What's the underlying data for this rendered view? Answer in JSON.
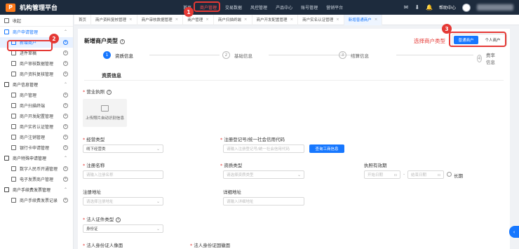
{
  "brand": {
    "name": "机构管理平台",
    "logo_text": "P"
  },
  "nav": [
    "首页",
    "商户管理",
    "交易数据",
    "风控管理",
    "产品中心",
    "账号管理",
    "营销平台"
  ],
  "top_right": {
    "help": "帮助中心",
    "icons": [
      "mail-icon",
      "download-icon",
      "bell-icon"
    ]
  },
  "sidebar": {
    "collapse": "收起",
    "items": [
      {
        "label": "商户申请管理",
        "type": "group",
        "open": true
      },
      {
        "label": "新增商户",
        "type": "item",
        "active": true
      },
      {
        "label": "进件草稿",
        "type": "item"
      },
      {
        "label": "商户审核数据管理",
        "type": "item"
      },
      {
        "label": "商户资料复核管理",
        "type": "item"
      },
      {
        "label": "商户信息管理",
        "type": "group"
      },
      {
        "label": "商户管理",
        "type": "item"
      },
      {
        "label": "商户扫描终端",
        "type": "item"
      },
      {
        "label": "商户开发配置管理",
        "type": "item"
      },
      {
        "label": "商户实名认证管理",
        "type": "item"
      },
      {
        "label": "商户注销管理",
        "type": "item"
      },
      {
        "label": "银行卡申请管理",
        "type": "item"
      },
      {
        "label": "商户特殊申请管理",
        "type": "group"
      },
      {
        "label": "数字人民币开通管理",
        "type": "item"
      },
      {
        "label": "电子发票商户管理",
        "type": "item"
      },
      {
        "label": "商户手续费发票管理",
        "type": "group"
      },
      {
        "label": "商户手续费发票记录",
        "type": "item"
      }
    ]
  },
  "tabs": [
    {
      "label": "首页",
      "closable": false
    },
    {
      "label": "商户资料复核管理",
      "closable": true
    },
    {
      "label": "商户审核数据管理",
      "closable": true
    },
    {
      "label": "商户管理",
      "closable": true
    },
    {
      "label": "商户扫描终端",
      "closable": true
    },
    {
      "label": "商户开发配置管理",
      "closable": true
    },
    {
      "label": "商户实名认证管理",
      "closable": true
    },
    {
      "label": "新增普通商户",
      "closable": true,
      "active": true
    }
  ],
  "page": {
    "title": "新增商户类型",
    "select_label": "选择商户类型",
    "types": [
      "普通商户",
      "个人商户"
    ],
    "active_type": "普通商户"
  },
  "steps": [
    {
      "num": "1",
      "label": "资质信息",
      "active": true
    },
    {
      "num": "2",
      "label": "基础信息"
    },
    {
      "num": "3",
      "label": "结算信息"
    },
    {
      "num": "4",
      "label": "费率信息"
    }
  ],
  "form": {
    "section": "资质信息",
    "license_label": "营业执照",
    "upload_text": "上传照片自动识别信息",
    "biz_type_label": "经营类型",
    "biz_type_value": "线下经营类",
    "reg_no_label": "注册登记号/统一社会信用代码",
    "reg_no_placeholder": "请输入注册登记号/统一社会信用代码",
    "query_btn": "查询工商信息",
    "reg_name_label": "注册名称",
    "reg_name_placeholder": "请输入注册名称",
    "qual_type_label": "资质类型",
    "qual_type_placeholder": "请选择资质类型",
    "validity_label": "执照有效期",
    "start_placeholder": "开始日期",
    "end_placeholder": "结束日期",
    "dash": "-",
    "long_term": "长期",
    "reg_addr_label": "注册地址",
    "reg_addr_placeholder": "请选择注册地址",
    "detail_addr_label": "详细地址",
    "detail_addr_placeholder": "请输入详细地址",
    "id_type_label": "法人证件类型",
    "id_type_value": "身份证",
    "id_front_label": "法人身份证人像面",
    "id_back_label": "法人身份证国徽面"
  },
  "annotations": [
    "1",
    "2",
    "3"
  ],
  "colors": {
    "accent": "#1677ff",
    "topbar": "#1d2b3d",
    "annotation": "#e53935",
    "logo": "#ff7a1a"
  }
}
